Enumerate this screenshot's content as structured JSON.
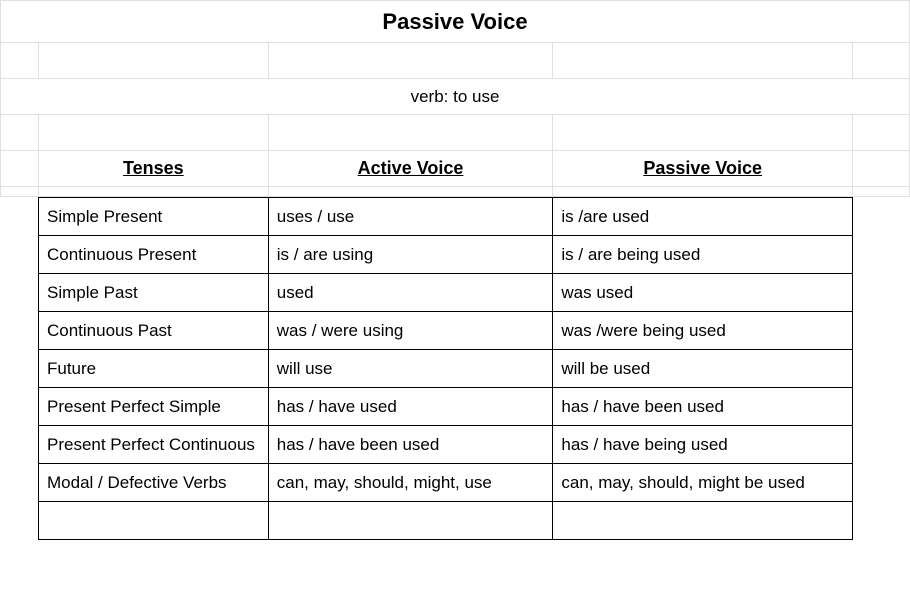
{
  "title": "Passive Voice",
  "subtitle": "verb: to use",
  "headers": {
    "tenses": "Tenses",
    "active": "Active Voice",
    "passive": "Passive Voice"
  },
  "rows": [
    {
      "tense": "Simple Present",
      "active": "uses / use",
      "passive": "is /are used"
    },
    {
      "tense": "Continuous Present",
      "active": "is / are using",
      "passive": "is / are being used"
    },
    {
      "tense": "Simple Past",
      "active": "used",
      "passive": "was used"
    },
    {
      "tense": "Continuous Past",
      "active": "was / were using",
      "passive": "was /were being used"
    },
    {
      "tense": "Future",
      "active": "will use",
      "passive": "will be used"
    },
    {
      "tense": "Present Perfect Simple",
      "active": "has / have used",
      "passive": "has / have been used"
    },
    {
      "tense": "Present Perfect Continuous",
      "active": "has / have been used",
      "passive": "has / have being used"
    },
    {
      "tense": "Modal / Defective Verbs",
      "active": "can, may, should, might, use",
      "passive": "can, may, should, might be used"
    }
  ]
}
